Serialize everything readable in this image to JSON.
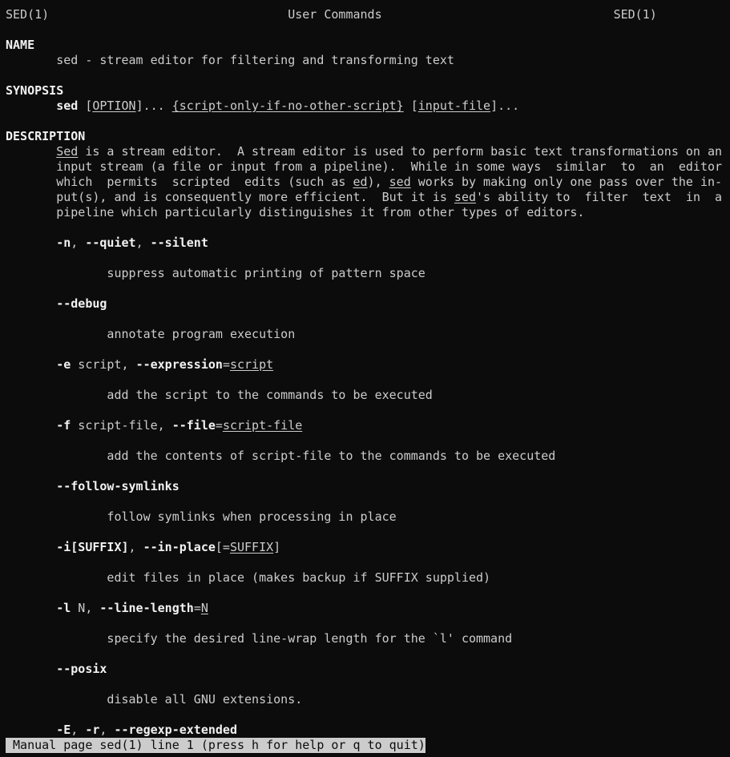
{
  "window": {
    "app": "terminal",
    "background": "#0c0c0c",
    "foreground": "#cccccc",
    "bold_foreground": "#f2f2f2"
  },
  "header": {
    "left": "SED(1)",
    "center": "User Commands",
    "right": "SED(1)"
  },
  "lines": [
    [
      {
        "t": "SED(1)                                 User Commands                                SED(1)"
      }
    ],
    [
      {
        "t": ""
      }
    ],
    [
      {
        "t": "NAME",
        "b": true
      }
    ],
    [
      {
        "t": "       sed - stream editor for filtering and transforming text"
      }
    ],
    [
      {
        "t": ""
      }
    ],
    [
      {
        "t": "SYNOPSIS",
        "b": true
      }
    ],
    [
      {
        "t": "       "
      },
      {
        "t": "sed",
        "b": true
      },
      {
        "t": " ["
      },
      {
        "t": "OPTION",
        "u": true
      },
      {
        "t": "]... "
      },
      {
        "t": "{script-only-if-no-other-script}",
        "u": true
      },
      {
        "t": " ["
      },
      {
        "t": "input-file",
        "u": true
      },
      {
        "t": "]..."
      }
    ],
    [
      {
        "t": ""
      }
    ],
    [
      {
        "t": "DESCRIPTION",
        "b": true
      }
    ],
    [
      {
        "t": "       "
      },
      {
        "t": "Sed",
        "u": true
      },
      {
        "t": " is a stream editor.  A stream editor is used to perform basic text transformations on an"
      }
    ],
    [
      {
        "t": "       input stream (a file or input from a pipeline).  While in some ways  similar  to  an  editor"
      }
    ],
    [
      {
        "t": "       which  permits  scripted  edits (such as "
      },
      {
        "t": "ed",
        "u": true
      },
      {
        "t": "), "
      },
      {
        "t": "sed",
        "u": true
      },
      {
        "t": " works by making only one pass over the in-"
      }
    ],
    [
      {
        "t": "       put(s), and is consequently more efficient.  But it is "
      },
      {
        "t": "sed",
        "u": true
      },
      {
        "t": "'s ability to  filter  text  in  a"
      }
    ],
    [
      {
        "t": "       pipeline which particularly distinguishes it from other types of editors."
      }
    ],
    [
      {
        "t": ""
      }
    ],
    [
      {
        "t": "       "
      },
      {
        "t": "-n",
        "b": true
      },
      {
        "t": ", "
      },
      {
        "t": "--quiet",
        "b": true
      },
      {
        "t": ", "
      },
      {
        "t": "--silent",
        "b": true
      }
    ],
    [
      {
        "t": ""
      }
    ],
    [
      {
        "t": "              suppress automatic printing of pattern space"
      }
    ],
    [
      {
        "t": ""
      }
    ],
    [
      {
        "t": "       "
      },
      {
        "t": "--debug",
        "b": true
      }
    ],
    [
      {
        "t": ""
      }
    ],
    [
      {
        "t": "              annotate program execution"
      }
    ],
    [
      {
        "t": ""
      }
    ],
    [
      {
        "t": "       "
      },
      {
        "t": "-e",
        "b": true
      },
      {
        "t": " script, "
      },
      {
        "t": "--expression",
        "b": true
      },
      {
        "t": "="
      },
      {
        "t": "script",
        "u": true
      }
    ],
    [
      {
        "t": ""
      }
    ],
    [
      {
        "t": "              add the script to the commands to be executed"
      }
    ],
    [
      {
        "t": ""
      }
    ],
    [
      {
        "t": "       "
      },
      {
        "t": "-f",
        "b": true
      },
      {
        "t": " script-file, "
      },
      {
        "t": "--file",
        "b": true
      },
      {
        "t": "="
      },
      {
        "t": "script-file",
        "u": true
      }
    ],
    [
      {
        "t": ""
      }
    ],
    [
      {
        "t": "              add the contents of script-file to the commands to be executed"
      }
    ],
    [
      {
        "t": ""
      }
    ],
    [
      {
        "t": "       "
      },
      {
        "t": "--follow-symlinks",
        "b": true
      }
    ],
    [
      {
        "t": ""
      }
    ],
    [
      {
        "t": "              follow symlinks when processing in place"
      }
    ],
    [
      {
        "t": ""
      }
    ],
    [
      {
        "t": "       "
      },
      {
        "t": "-i[SUFFIX]",
        "b": true
      },
      {
        "t": ", "
      },
      {
        "t": "--in-place",
        "b": true
      },
      {
        "t": "[="
      },
      {
        "t": "SUFFIX",
        "u": true
      },
      {
        "t": "]"
      }
    ],
    [
      {
        "t": ""
      }
    ],
    [
      {
        "t": "              edit files in place (makes backup if SUFFIX supplied)"
      }
    ],
    [
      {
        "t": ""
      }
    ],
    [
      {
        "t": "       "
      },
      {
        "t": "-l",
        "b": true
      },
      {
        "t": " N, "
      },
      {
        "t": "--line-length",
        "b": true
      },
      {
        "t": "="
      },
      {
        "t": "N",
        "u": true
      }
    ],
    [
      {
        "t": ""
      }
    ],
    [
      {
        "t": "              specify the desired line-wrap length for the `l' command"
      }
    ],
    [
      {
        "t": ""
      }
    ],
    [
      {
        "t": "       "
      },
      {
        "t": "--posix",
        "b": true
      }
    ],
    [
      {
        "t": ""
      }
    ],
    [
      {
        "t": "              disable all GNU extensions."
      }
    ],
    [
      {
        "t": ""
      }
    ],
    [
      {
        "t": "       "
      },
      {
        "t": "-E",
        "b": true
      },
      {
        "t": ", "
      },
      {
        "t": "-r",
        "b": true
      },
      {
        "t": ", "
      },
      {
        "t": "--regexp-extended",
        "b": true
      }
    ]
  ],
  "status_bar": {
    "text": " Manual page sed(1) line 1 (press h for help or q to quit)",
    "background": "#cccccc",
    "foreground": "#0c0c0c"
  }
}
